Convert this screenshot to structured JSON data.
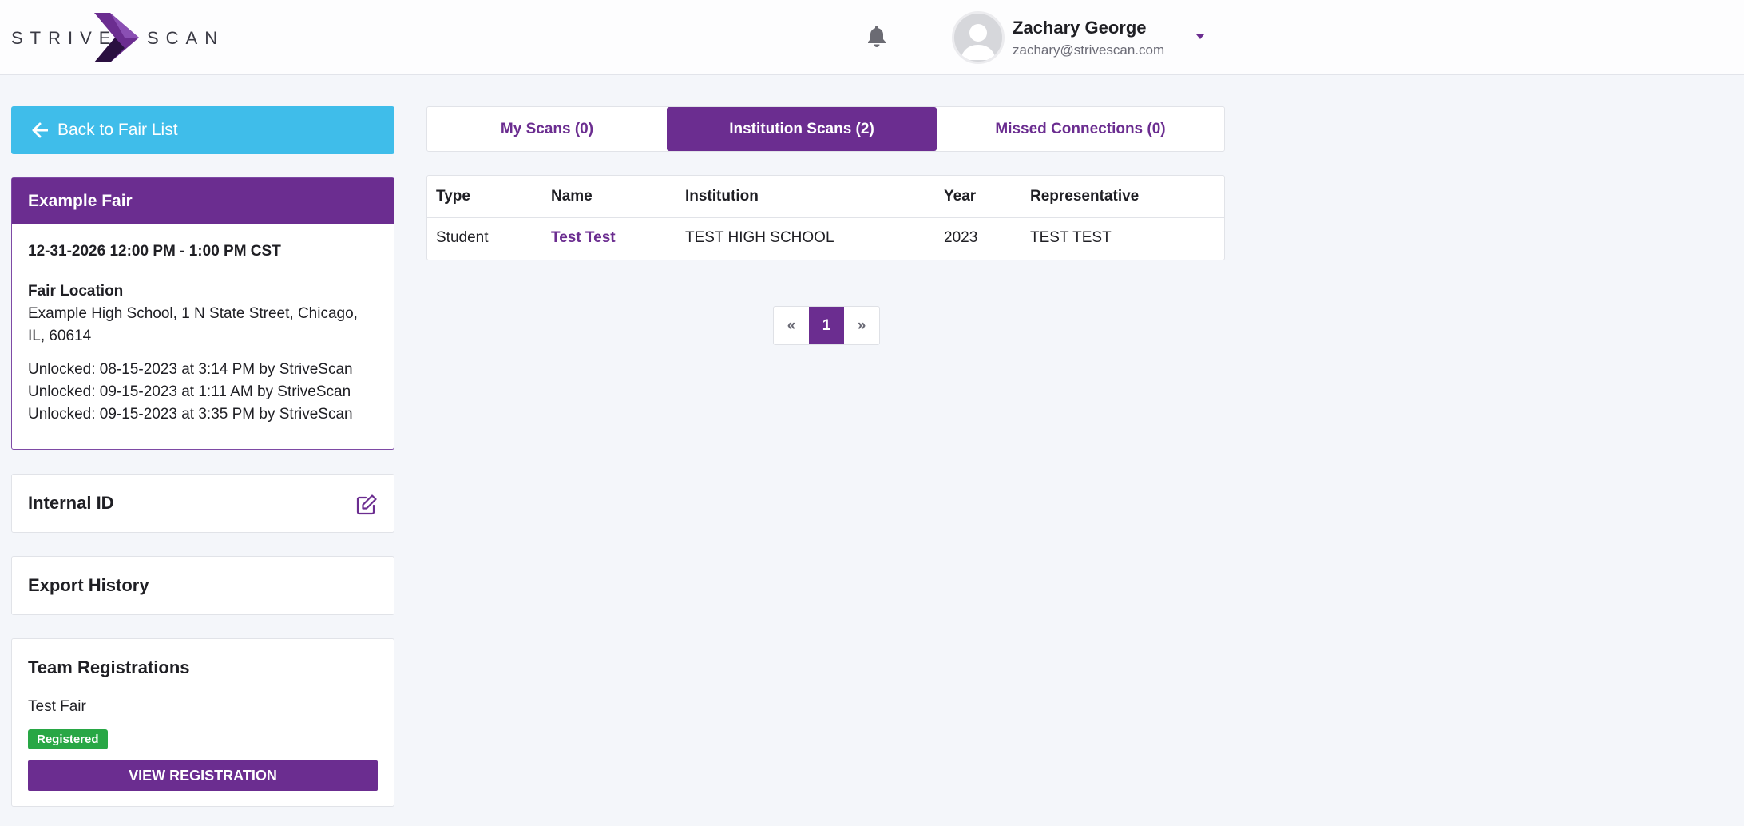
{
  "header": {
    "logo_left": "STRIVE",
    "logo_right": "SCAN",
    "user_name": "Zachary George",
    "user_email": "zachary@strivescan.com"
  },
  "sidebar": {
    "back_label": "Back to Fair List",
    "fair": {
      "title": "Example Fair",
      "datetime": "12-31-2026 12:00 PM - 1:00 PM CST",
      "location_label": "Fair Location",
      "location": "Example High School, 1 N State Street, Chicago, IL, 60614",
      "unlocks": [
        "Unlocked: 08-15-2023 at 3:14 PM by StriveScan",
        "Unlocked: 09-15-2023 at 1:11 AM by StriveScan",
        "Unlocked: 09-15-2023 at 3:35 PM by StriveScan"
      ]
    },
    "internal_id_title": "Internal ID",
    "export_history_title": "Export History",
    "team": {
      "title": "Team Registrations",
      "fair_name": "Test Fair",
      "status": "Registered",
      "button": "VIEW REGISTRATION"
    }
  },
  "tabs": [
    {
      "label": "My Scans (0)",
      "active": false
    },
    {
      "label": "Institution Scans (2)",
      "active": true
    },
    {
      "label": "Missed Connections (0)",
      "active": false
    }
  ],
  "table": {
    "headers": [
      "Type",
      "Name",
      "Institution",
      "Year",
      "Representative"
    ],
    "rows": [
      [
        "Student",
        "Test Test",
        "TEST HIGH SCHOOL",
        "2023",
        "TEST TEST"
      ]
    ]
  },
  "pagination": {
    "prev": "«",
    "current": "1",
    "next": "»"
  },
  "colors": {
    "brand_purple": "#6b2d90",
    "back_button_blue": "#3fbdea",
    "registered_green": "#28a745"
  },
  "icons": [
    "arrow-left-icon",
    "bell-icon",
    "user-avatar-icon",
    "chevron-down-icon",
    "edit-icon"
  ]
}
